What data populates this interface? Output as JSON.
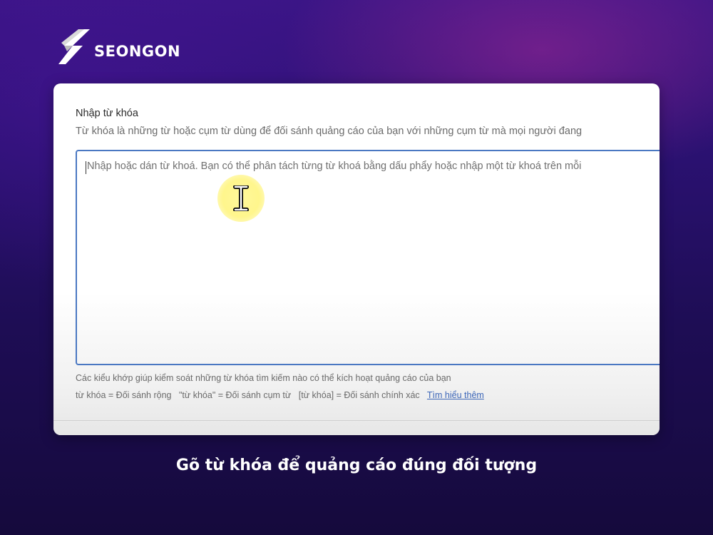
{
  "brand": {
    "name": "SEONGON",
    "logo_icon": "s-logo-icon"
  },
  "keyword_section": {
    "title": "Nhập từ khóa",
    "description": "Từ khóa là những từ hoặc cụm từ dùng để đối sánh quảng cáo của bạn với những cụm từ mà mọi người đang",
    "input": {
      "value": "",
      "placeholder": "Nhập hoặc dán từ khoá. Bạn có thể phân tách từng từ khoá bằng dấu phẩy hoặc nhập một từ khoá trên mỗi"
    },
    "cursor_icon": "text-cursor-icon",
    "match_info": "Các kiểu khớp giúp kiểm soát những từ khóa tìm kiếm nào có thể kích hoạt quảng cáo của bạn",
    "match_types": [
      "từ khóa = Đối sánh rộng",
      "\"từ khóa\" = Đối sánh cụm từ",
      "[từ khóa] = Đối sánh chính xác"
    ],
    "learn_more": "Tìm hiểu thêm"
  },
  "caption": "Gõ từ khóa để quảng cáo đúng đối tượng",
  "colors": {
    "input_border": "#4a78c2",
    "link": "#3c66b8",
    "cursor_highlight": "#fff478"
  }
}
